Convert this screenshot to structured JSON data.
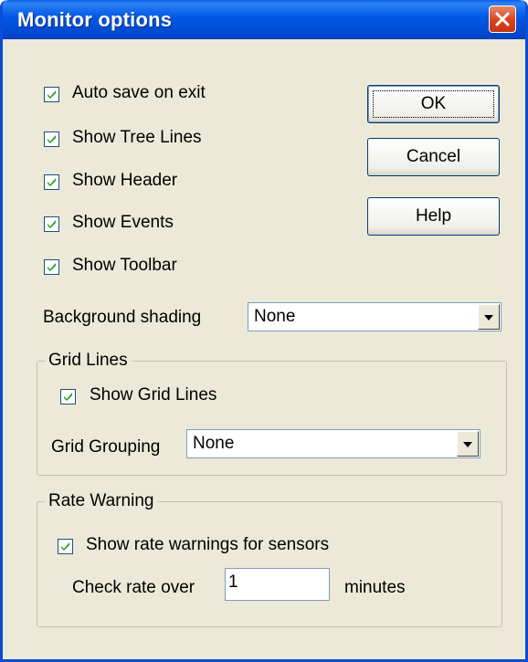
{
  "window": {
    "title": "Monitor options"
  },
  "options": [
    {
      "label": "Auto save on exit",
      "checked": true
    },
    {
      "label": "Show Tree Lines",
      "checked": true
    },
    {
      "label": "Show Header",
      "checked": true
    },
    {
      "label": "Show Events",
      "checked": true
    },
    {
      "label": "Show Toolbar",
      "checked": true
    }
  ],
  "buttons": {
    "ok": "OK",
    "cancel": "Cancel",
    "help": "Help"
  },
  "background_shading": {
    "label": "Background shading",
    "value": "None"
  },
  "grid_lines": {
    "title": "Grid Lines",
    "show_label": "Show Grid Lines",
    "show_checked": true,
    "grouping_label": "Grid Grouping",
    "grouping_value": "None"
  },
  "rate_warning": {
    "title": "Rate Warning",
    "show_label": "Show rate warnings for sensors",
    "show_checked": true,
    "check_label": "Check rate over",
    "check_value": "1",
    "unit_label": "minutes"
  },
  "icons": {
    "close": "close-icon",
    "check": "checkmark-icon",
    "dropdown": "chevron-down-icon"
  },
  "colors": {
    "titlebar": "#0054e3",
    "close": "#d8421c",
    "dialog": "#ece9d8"
  }
}
